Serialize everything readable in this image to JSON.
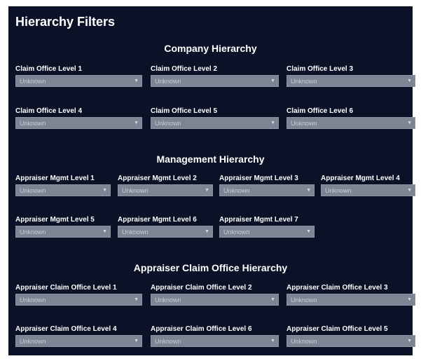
{
  "title": "Hierarchy Filters",
  "sections": {
    "company": {
      "title": "Company Hierarchy",
      "fields": [
        {
          "label": "Claim Office Level 1",
          "value": "Unknown"
        },
        {
          "label": "Claim Office Level 2",
          "value": "Unknown"
        },
        {
          "label": "Claim Office Level 3",
          "value": "Unknown"
        },
        {
          "label": "Claim Office Level 4",
          "value": "Unknown"
        },
        {
          "label": "Claim Office Level 5",
          "value": "Unknown"
        },
        {
          "label": "Claim Office Level 6",
          "value": "Unknown"
        }
      ]
    },
    "management": {
      "title": "Management Hierarchy",
      "fields": [
        {
          "label": "Appraiser Mgmt Level 1",
          "value": "Unknown"
        },
        {
          "label": "Appraiser Mgmt Level 2",
          "value": "Unknown"
        },
        {
          "label": "Appraiser Mgmt Level 3",
          "value": "Unknown"
        },
        {
          "label": "Appraiser Mgmt Level 4",
          "value": "Unknown"
        },
        {
          "label": "Appraiser Mgmt Level 5",
          "value": "Unknown"
        },
        {
          "label": "Appraiser Mgmt Level 6",
          "value": "Unknown"
        },
        {
          "label": "Appraiser Mgmt Level 7",
          "value": "Unknown"
        }
      ]
    },
    "appraiser_claim_office": {
      "title": "Appraiser Claim Office Hierarchy",
      "fields": [
        {
          "label": "Appraiser Claim Office Level 1",
          "value": "Unknown"
        },
        {
          "label": "Appraiser Claim Office Level 2",
          "value": "Unknown"
        },
        {
          "label": "Appraiser Claim Office Level 3",
          "value": "Unknown"
        },
        {
          "label": "Appraiser Claim Office Level 4",
          "value": "Unknown"
        },
        {
          "label": "Appraiser Claim Office Level 6",
          "value": "Unknown"
        },
        {
          "label": "Appraiser Claim Office Level 5",
          "value": "Unknown"
        }
      ]
    }
  },
  "icons": {
    "dropdown": "chevron-down-icon"
  },
  "colors": {
    "background": "#0b1228",
    "dropdown": "#7d8595",
    "text": "#ffffff"
  }
}
